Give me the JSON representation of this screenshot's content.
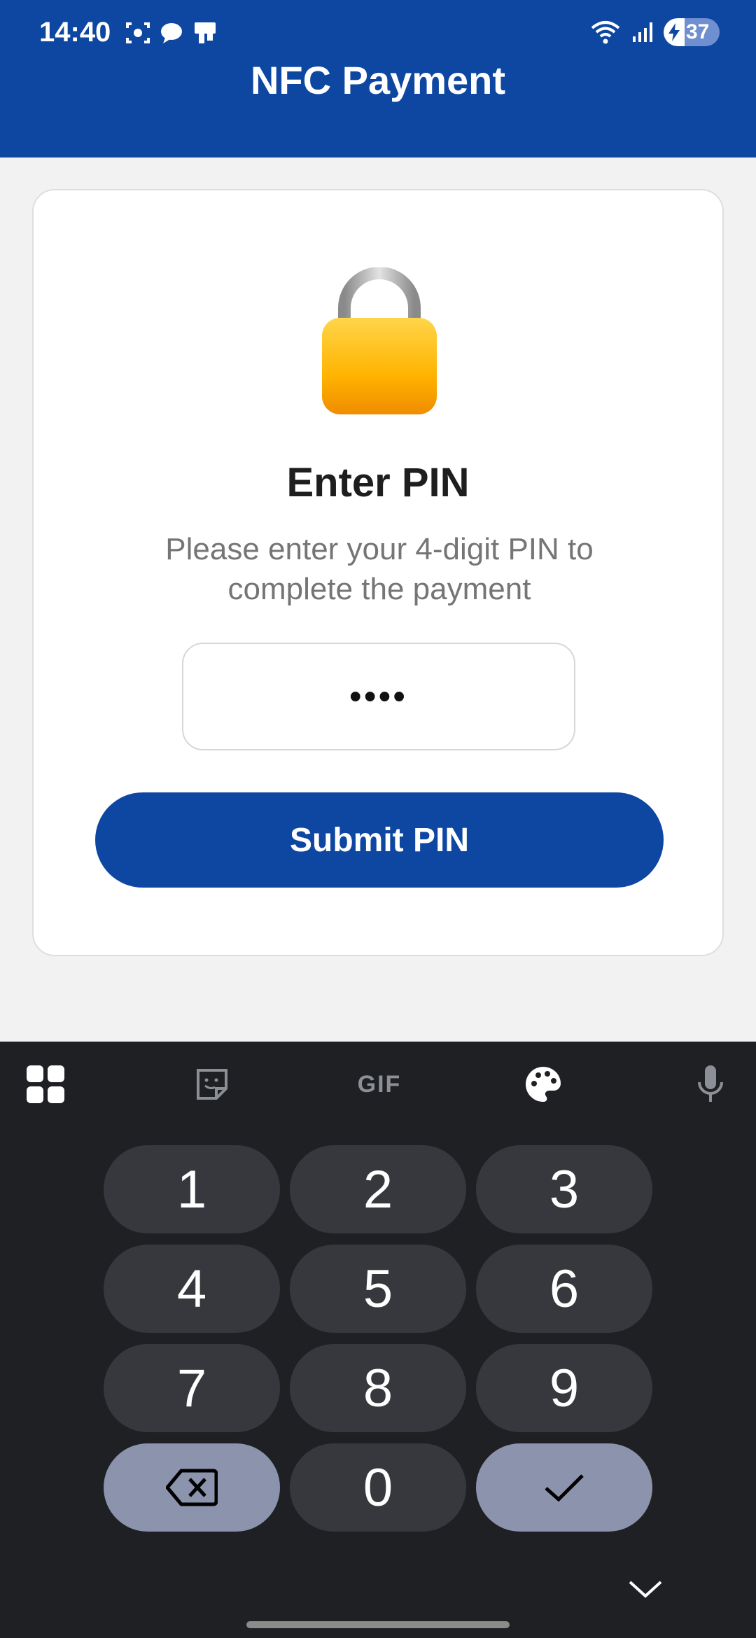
{
  "status_bar": {
    "time": "14:40",
    "battery": "37"
  },
  "app_bar": {
    "title": "NFC Payment"
  },
  "pin_card": {
    "icon": "lock-icon",
    "title": "Enter PIN",
    "description": "Please enter your 4-digit PIN to complete the payment",
    "pin_value": "••••",
    "submit_label": "Submit PIN"
  },
  "keyboard": {
    "toolbar": {
      "gif_label": "GIF"
    },
    "keys": {
      "k1": "1",
      "k2": "2",
      "k3": "3",
      "k4": "4",
      "k5": "5",
      "k6": "6",
      "k7": "7",
      "k8": "8",
      "k9": "9",
      "k0": "0"
    }
  },
  "colors": {
    "primary": "#0e47a1",
    "keyboard_bg": "#1f2023",
    "key_bg": "#37383d",
    "special_key_bg": "#8c93ac"
  }
}
